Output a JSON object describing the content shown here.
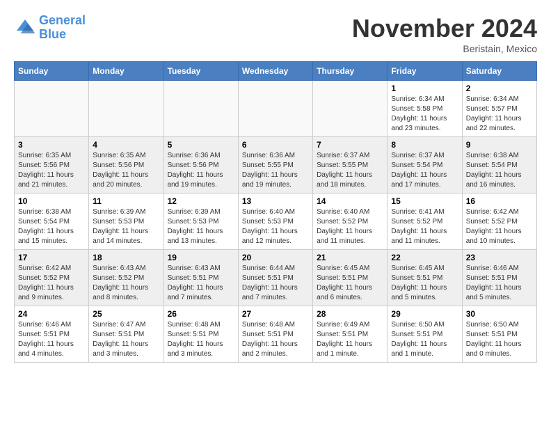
{
  "header": {
    "logo_line1": "General",
    "logo_line2": "Blue",
    "month": "November 2024",
    "location": "Beristain, Mexico"
  },
  "weekdays": [
    "Sunday",
    "Monday",
    "Tuesday",
    "Wednesday",
    "Thursday",
    "Friday",
    "Saturday"
  ],
  "weeks": [
    [
      {
        "day": "",
        "empty": true
      },
      {
        "day": "",
        "empty": true
      },
      {
        "day": "",
        "empty": true
      },
      {
        "day": "",
        "empty": true
      },
      {
        "day": "",
        "empty": true
      },
      {
        "day": "1",
        "sunrise": "Sunrise: 6:34 AM",
        "sunset": "Sunset: 5:58 PM",
        "daylight": "Daylight: 11 hours and 23 minutes."
      },
      {
        "day": "2",
        "sunrise": "Sunrise: 6:34 AM",
        "sunset": "Sunset: 5:57 PM",
        "daylight": "Daylight: 11 hours and 22 minutes."
      }
    ],
    [
      {
        "day": "3",
        "sunrise": "Sunrise: 6:35 AM",
        "sunset": "Sunset: 5:56 PM",
        "daylight": "Daylight: 11 hours and 21 minutes."
      },
      {
        "day": "4",
        "sunrise": "Sunrise: 6:35 AM",
        "sunset": "Sunset: 5:56 PM",
        "daylight": "Daylight: 11 hours and 20 minutes."
      },
      {
        "day": "5",
        "sunrise": "Sunrise: 6:36 AM",
        "sunset": "Sunset: 5:56 PM",
        "daylight": "Daylight: 11 hours and 19 minutes."
      },
      {
        "day": "6",
        "sunrise": "Sunrise: 6:36 AM",
        "sunset": "Sunset: 5:55 PM",
        "daylight": "Daylight: 11 hours and 19 minutes."
      },
      {
        "day": "7",
        "sunrise": "Sunrise: 6:37 AM",
        "sunset": "Sunset: 5:55 PM",
        "daylight": "Daylight: 11 hours and 18 minutes."
      },
      {
        "day": "8",
        "sunrise": "Sunrise: 6:37 AM",
        "sunset": "Sunset: 5:54 PM",
        "daylight": "Daylight: 11 hours and 17 minutes."
      },
      {
        "day": "9",
        "sunrise": "Sunrise: 6:38 AM",
        "sunset": "Sunset: 5:54 PM",
        "daylight": "Daylight: 11 hours and 16 minutes."
      }
    ],
    [
      {
        "day": "10",
        "sunrise": "Sunrise: 6:38 AM",
        "sunset": "Sunset: 5:54 PM",
        "daylight": "Daylight: 11 hours and 15 minutes."
      },
      {
        "day": "11",
        "sunrise": "Sunrise: 6:39 AM",
        "sunset": "Sunset: 5:53 PM",
        "daylight": "Daylight: 11 hours and 14 minutes."
      },
      {
        "day": "12",
        "sunrise": "Sunrise: 6:39 AM",
        "sunset": "Sunset: 5:53 PM",
        "daylight": "Daylight: 11 hours and 13 minutes."
      },
      {
        "day": "13",
        "sunrise": "Sunrise: 6:40 AM",
        "sunset": "Sunset: 5:53 PM",
        "daylight": "Daylight: 11 hours and 12 minutes."
      },
      {
        "day": "14",
        "sunrise": "Sunrise: 6:40 AM",
        "sunset": "Sunset: 5:52 PM",
        "daylight": "Daylight: 11 hours and 11 minutes."
      },
      {
        "day": "15",
        "sunrise": "Sunrise: 6:41 AM",
        "sunset": "Sunset: 5:52 PM",
        "daylight": "Daylight: 11 hours and 11 minutes."
      },
      {
        "day": "16",
        "sunrise": "Sunrise: 6:42 AM",
        "sunset": "Sunset: 5:52 PM",
        "daylight": "Daylight: 11 hours and 10 minutes."
      }
    ],
    [
      {
        "day": "17",
        "sunrise": "Sunrise: 6:42 AM",
        "sunset": "Sunset: 5:52 PM",
        "daylight": "Daylight: 11 hours and 9 minutes."
      },
      {
        "day": "18",
        "sunrise": "Sunrise: 6:43 AM",
        "sunset": "Sunset: 5:52 PM",
        "daylight": "Daylight: 11 hours and 8 minutes."
      },
      {
        "day": "19",
        "sunrise": "Sunrise: 6:43 AM",
        "sunset": "Sunset: 5:51 PM",
        "daylight": "Daylight: 11 hours and 7 minutes."
      },
      {
        "day": "20",
        "sunrise": "Sunrise: 6:44 AM",
        "sunset": "Sunset: 5:51 PM",
        "daylight": "Daylight: 11 hours and 7 minutes."
      },
      {
        "day": "21",
        "sunrise": "Sunrise: 6:45 AM",
        "sunset": "Sunset: 5:51 PM",
        "daylight": "Daylight: 11 hours and 6 minutes."
      },
      {
        "day": "22",
        "sunrise": "Sunrise: 6:45 AM",
        "sunset": "Sunset: 5:51 PM",
        "daylight": "Daylight: 11 hours and 5 minutes."
      },
      {
        "day": "23",
        "sunrise": "Sunrise: 6:46 AM",
        "sunset": "Sunset: 5:51 PM",
        "daylight": "Daylight: 11 hours and 5 minutes."
      }
    ],
    [
      {
        "day": "24",
        "sunrise": "Sunrise: 6:46 AM",
        "sunset": "Sunset: 5:51 PM",
        "daylight": "Daylight: 11 hours and 4 minutes."
      },
      {
        "day": "25",
        "sunrise": "Sunrise: 6:47 AM",
        "sunset": "Sunset: 5:51 PM",
        "daylight": "Daylight: 11 hours and 3 minutes."
      },
      {
        "day": "26",
        "sunrise": "Sunrise: 6:48 AM",
        "sunset": "Sunset: 5:51 PM",
        "daylight": "Daylight: 11 hours and 3 minutes."
      },
      {
        "day": "27",
        "sunrise": "Sunrise: 6:48 AM",
        "sunset": "Sunset: 5:51 PM",
        "daylight": "Daylight: 11 hours and 2 minutes."
      },
      {
        "day": "28",
        "sunrise": "Sunrise: 6:49 AM",
        "sunset": "Sunset: 5:51 PM",
        "daylight": "Daylight: 11 hours and 1 minute."
      },
      {
        "day": "29",
        "sunrise": "Sunrise: 6:50 AM",
        "sunset": "Sunset: 5:51 PM",
        "daylight": "Daylight: 11 hours and 1 minute."
      },
      {
        "day": "30",
        "sunrise": "Sunrise: 6:50 AM",
        "sunset": "Sunset: 5:51 PM",
        "daylight": "Daylight: 11 hours and 0 minutes."
      }
    ]
  ]
}
